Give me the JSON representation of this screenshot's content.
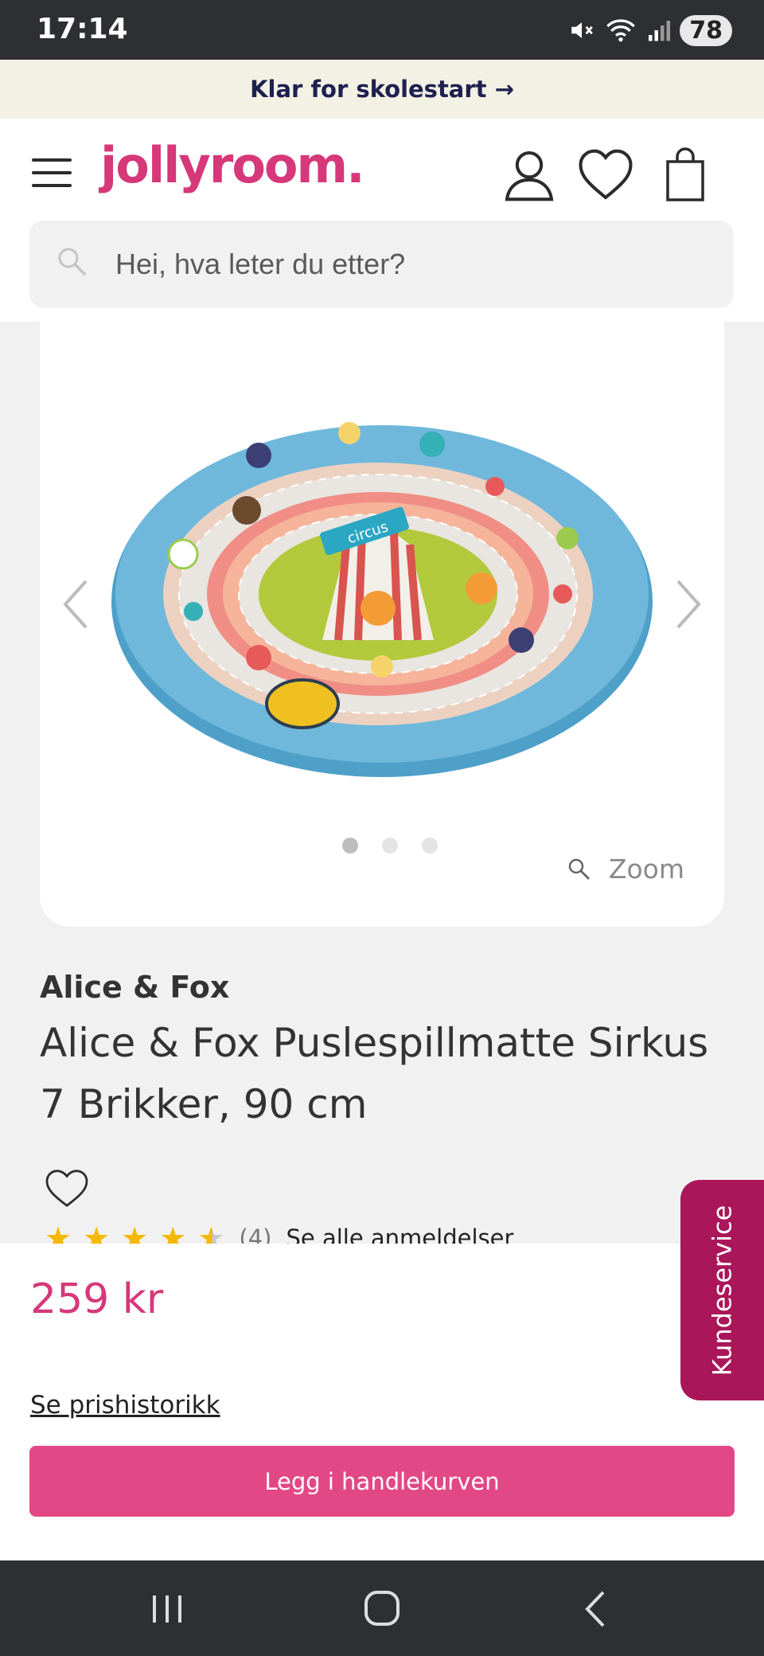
{
  "status_bar": {
    "time": "17:14",
    "battery": "78"
  },
  "promo": {
    "text": "Klar for skolestart →"
  },
  "header": {
    "logo": "jollyroom.",
    "search_placeholder": "Hei, hva leter du etter?"
  },
  "gallery": {
    "image_count": 3,
    "active_index": 0,
    "zoom_label": "Zoom"
  },
  "product": {
    "brand": "Alice & Fox",
    "title": "Alice & Fox Puslespillmatte Sirkus 7 Brikker, 90 cm",
    "rating": 4.5,
    "stars": [
      "★",
      "★",
      "★",
      "★",
      "★"
    ],
    "review_count": "(4)",
    "reviews_link": "Se alle anmeldelser",
    "price": "259 kr",
    "price_history_link": "Se prishistorikk",
    "add_to_cart": "Legg i handlekurven"
  },
  "customer_service": {
    "label": "Kundeservice"
  },
  "colors": {
    "brand_pink": "#d6387a",
    "button_pink": "#e24886",
    "service_tab": "#a9175a",
    "star": "#f5b800"
  }
}
